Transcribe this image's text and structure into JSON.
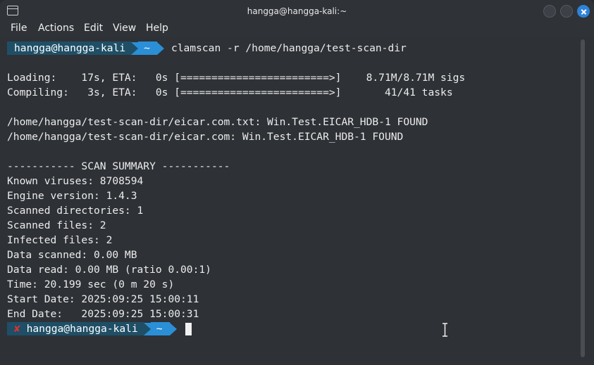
{
  "window": {
    "title": "hangga@hangga-kali:~"
  },
  "menu": [
    "File",
    "Actions",
    "Edit",
    "View",
    "Help"
  ],
  "prompt": {
    "user_host": "hangga@hangga-kali",
    "dir": "~",
    "command": "clamscan -r /home/hangga/test-scan-dir",
    "error_mark": "✘"
  },
  "output": [
    "",
    "Loading:    17s, ETA:   0s [========================>]    8.71M/8.71M sigs",
    "Compiling:   3s, ETA:   0s [========================>]       41/41 tasks",
    "",
    "/home/hangga/test-scan-dir/eicar.com.txt: Win.Test.EICAR_HDB-1 FOUND",
    "/home/hangga/test-scan-dir/eicar.com: Win.Test.EICAR_HDB-1 FOUND",
    "",
    "----------- SCAN SUMMARY -----------",
    "Known viruses: 8708594",
    "Engine version: 1.4.3",
    "Scanned directories: 1",
    "Scanned files: 2",
    "Infected files: 2",
    "Data scanned: 0.00 MB",
    "Data read: 0.00 MB (ratio 0.00:1)",
    "Time: 20.199 sec (0 m 20 s)",
    "Start Date: 2025:09:25 15:00:11",
    "End Date:   2025:09:25 15:00:31"
  ],
  "colors": {
    "background": "#2e3136",
    "prompt_user_bg": "#1f4f66",
    "prompt_dir_bg": "#2a8fd6",
    "error": "#e0312f",
    "close_button": "#2d83d8"
  }
}
